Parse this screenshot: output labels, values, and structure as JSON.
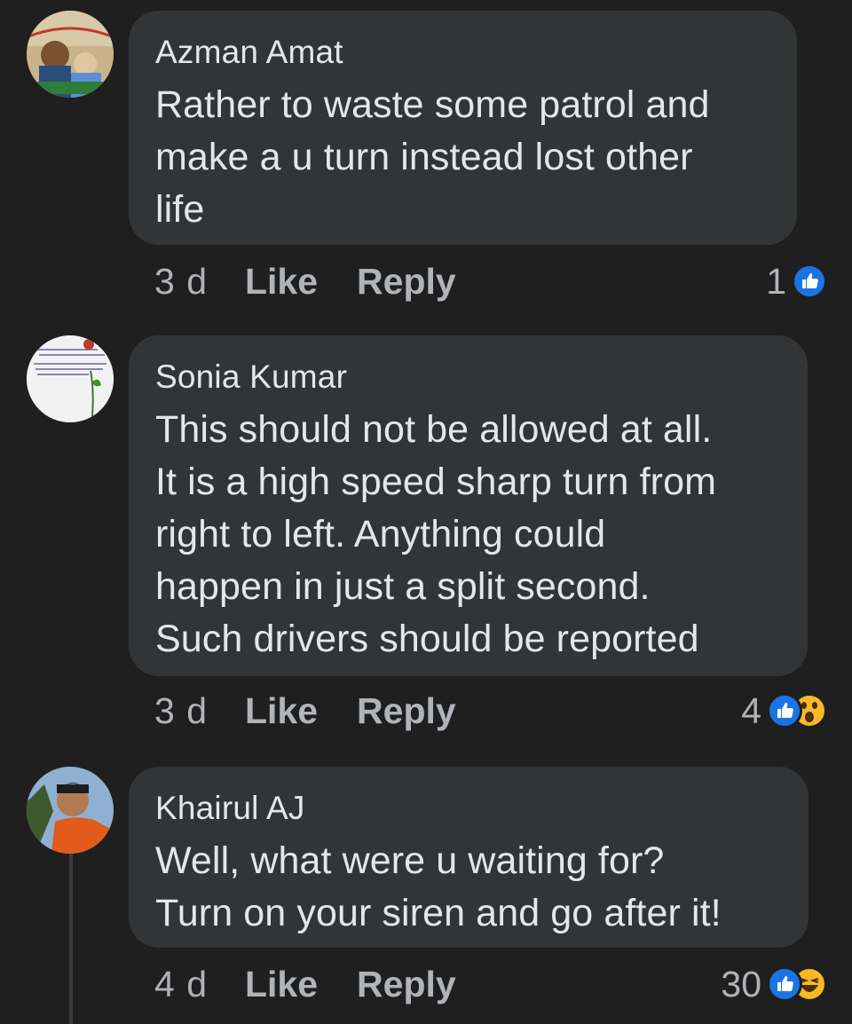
{
  "comments": [
    {
      "author": "Azman Amat",
      "text_lines": [
        "Rather to waste some patrol and",
        "make a u turn instead lost other",
        "life"
      ],
      "time": "3 d",
      "like_label": "Like",
      "reply_label": "Reply",
      "reaction_count": "1",
      "reactions": [
        "like-icon"
      ]
    },
    {
      "author": "Sonia Kumar",
      "text_lines": [
        "This should not be allowed at all.",
        "It is a high speed sharp turn from",
        "right to left. Anything could",
        "happen in just a split second.",
        "Such drivers should be reported"
      ],
      "time": "3 d",
      "like_label": "Like",
      "reply_label": "Reply",
      "reaction_count": "4",
      "reactions": [
        "like-icon",
        "wow-icon"
      ]
    },
    {
      "author": "Khairul AJ",
      "text_lines": [
        "Well, what were u waiting for?",
        "Turn on your siren and go after it!"
      ],
      "time": "4 d",
      "like_label": "Like",
      "reply_label": "Reply",
      "reaction_count": "30",
      "reactions": [
        "like-icon",
        "haha-icon"
      ]
    }
  ],
  "colors": {
    "background": "#1f1f20",
    "bubble": "#333436",
    "text": "#e4e6eb",
    "secondary_text": "#b0b3b8",
    "like_blue": "#1b74e4",
    "emoji_yellow": "#f7b928"
  }
}
